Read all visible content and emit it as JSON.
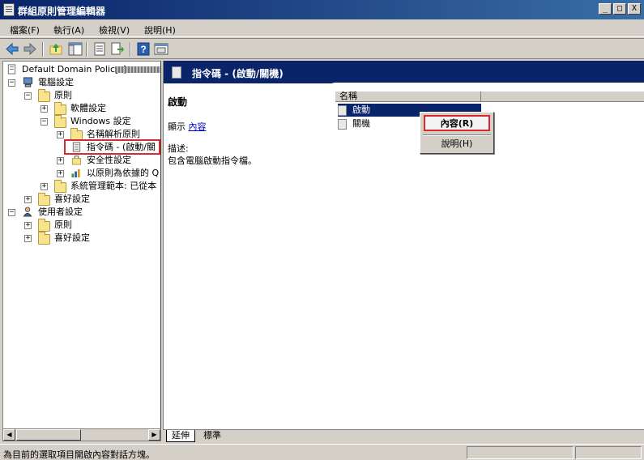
{
  "window": {
    "title": "群組原則管理編輯器",
    "controls": [
      "_",
      "□",
      "X"
    ]
  },
  "menu": [
    "檔案(F)",
    "執行(A)",
    "檢視(V)",
    "說明(H)"
  ],
  "toolbar": {
    "icons": [
      "back-arrow-icon",
      "forward-arrow-icon",
      "up-folder-icon",
      "show-tree-icon",
      "properties-icon",
      "export-icon",
      "help-icon",
      "console-icon"
    ]
  },
  "tree": {
    "root": "Default Domain Policy [",
    "computer_config": "電腦設定",
    "policies": "原則",
    "software_settings": "軟體設定",
    "windows_settings": "Windows 設定",
    "name_resolution": "名稱解析原則",
    "scripts": "指令碼 - (啟動/關",
    "security_settings": "安全性設定",
    "policy_based": "以原則為依據的 Q",
    "admin_templates": "系統管理範本: 已從本",
    "preferences": "喜好設定",
    "user_config": "使用者設定",
    "user_policies": "原則",
    "user_preferences": "喜好設定"
  },
  "right": {
    "header_title": "指令碼 - (啟動/關機)",
    "ext_title": "啟動",
    "show_label": "顯示 ",
    "show_link": "內容",
    "desc_label": "描述:",
    "desc_text": "包含電腦啟動指令檔。",
    "column_name": "名稱",
    "rows": [
      "啟動",
      "關機"
    ]
  },
  "context_menu": {
    "properties": "內容(R)",
    "help": "說明(H)"
  },
  "tabs": [
    "延伸",
    "標準"
  ],
  "status": "為目前的選取項目開啟內容對話方塊。",
  "colors": {
    "accent": "#0a246a",
    "highlight_red": "#d9282f",
    "chrome": "#d4d0c8"
  }
}
